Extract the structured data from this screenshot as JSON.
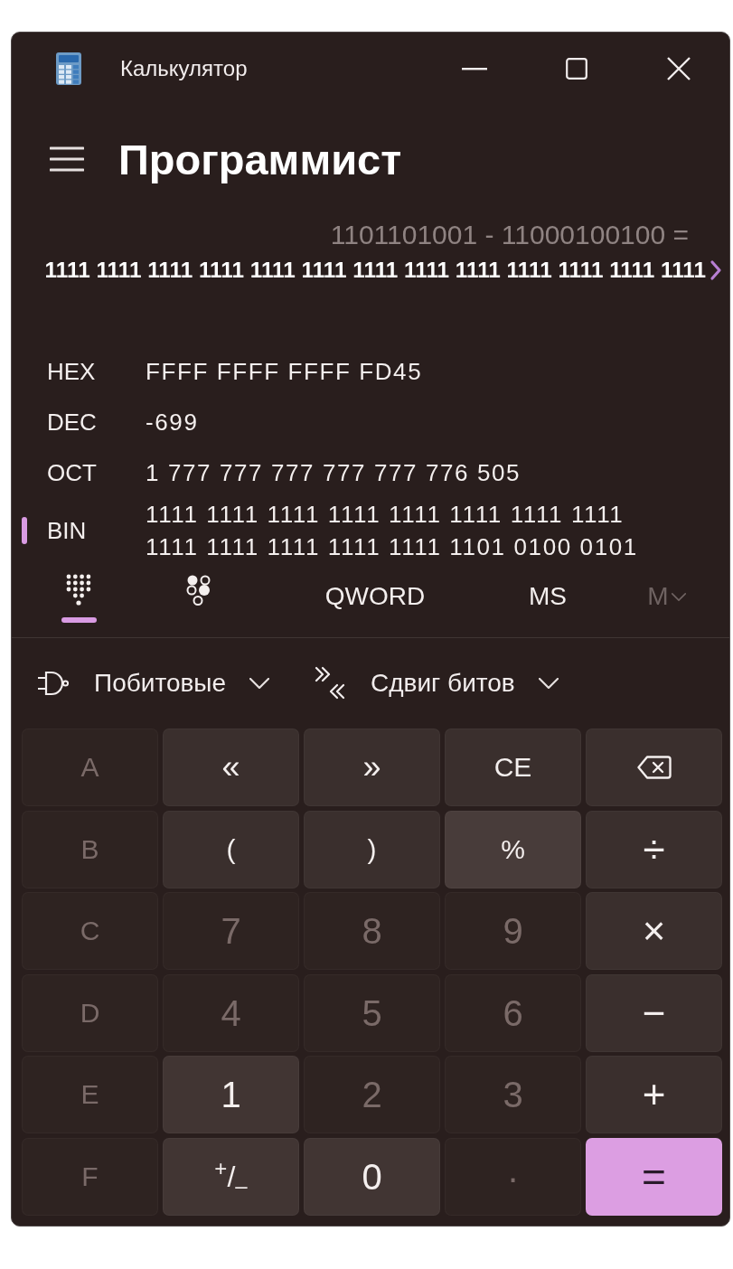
{
  "window": {
    "title": "Калькулятор"
  },
  "header": {
    "title": "Программист"
  },
  "display": {
    "expression": "1101101001 - 11000100100 =",
    "result": "1111 1111 1111 1111 1111 1111 1111 1111 1111 1111 1111 1111 1111"
  },
  "radix": [
    {
      "label": "HEX",
      "value": "FFFF FFFF FFFF FD45",
      "selected": false
    },
    {
      "label": "DEC",
      "value": "-699",
      "selected": false
    },
    {
      "label": "OCT",
      "value": "1 777 777 777 777 777 776 505",
      "selected": false
    },
    {
      "label": "BIN",
      "value": "1111 1111 1111 1111 1111 1111 1111 1111 1111 1111 1111 1111 1111 1101 0100 0101",
      "selected": true
    }
  ],
  "toolbar": {
    "tabs": [
      {
        "kind": "keypad",
        "selected": true
      },
      {
        "kind": "bit_toggle",
        "selected": false
      }
    ],
    "word_size": "QWORD",
    "memory": [
      {
        "kind": "store",
        "label": "MS",
        "disabled": false
      },
      {
        "kind": "list",
        "label": "M",
        "disabled": true
      }
    ]
  },
  "dropdowns": [
    {
      "kind": "bitwise",
      "label": "Побитовые"
    },
    {
      "kind": "shift",
      "label": "Сдвиг битов"
    }
  ],
  "keys": [
    {
      "kind": "hex",
      "label": "A",
      "disabled": true,
      "hovered": false
    },
    {
      "kind": "shift",
      "label": "«",
      "disabled": false,
      "hovered": false
    },
    {
      "kind": "shift",
      "label": "»",
      "disabled": false,
      "hovered": false
    },
    {
      "kind": "function",
      "label": "CE",
      "disabled": false,
      "hovered": false
    },
    {
      "kind": "backspace",
      "disabled": false,
      "hovered": false
    },
    {
      "kind": "hex",
      "label": "B",
      "disabled": true,
      "hovered": false
    },
    {
      "kind": "function",
      "label": "(",
      "disabled": false,
      "hovered": false
    },
    {
      "kind": "function",
      "label": ")",
      "disabled": false,
      "hovered": false
    },
    {
      "kind": "function",
      "label": "%",
      "disabled": false,
      "hovered": true
    },
    {
      "kind": "operator",
      "label": "÷",
      "disabled": false,
      "hovered": false
    },
    {
      "kind": "hex",
      "label": "C",
      "disabled": true,
      "hovered": false
    },
    {
      "kind": "digit",
      "label": "7",
      "disabled": true,
      "hovered": false
    },
    {
      "kind": "digit",
      "label": "8",
      "disabled": true,
      "hovered": false
    },
    {
      "kind": "digit",
      "label": "9",
      "disabled": true,
      "hovered": false
    },
    {
      "kind": "operator",
      "label": "×",
      "disabled": false,
      "hovered": false
    },
    {
      "kind": "hex",
      "label": "D",
      "disabled": true,
      "hovered": false
    },
    {
      "kind": "digit",
      "label": "4",
      "disabled": true,
      "hovered": false
    },
    {
      "kind": "digit",
      "label": "5",
      "disabled": true,
      "hovered": false
    },
    {
      "kind": "digit",
      "label": "6",
      "disabled": true,
      "hovered": false
    },
    {
      "kind": "operator",
      "label": "−",
      "disabled": false,
      "hovered": false
    },
    {
      "kind": "hex",
      "label": "E",
      "disabled": true,
      "hovered": false
    },
    {
      "kind": "digit",
      "label": "1",
      "disabled": false,
      "hovered": false
    },
    {
      "kind": "digit",
      "label": "2",
      "disabled": true,
      "hovered": false
    },
    {
      "kind": "digit",
      "label": "3",
      "disabled": true,
      "hovered": false
    },
    {
      "kind": "operator",
      "label": "+",
      "disabled": false,
      "hovered": false
    },
    {
      "kind": "hex",
      "label": "F",
      "disabled": true,
      "hovered": false
    },
    {
      "kind": "sign",
      "label": "$^{+}$/$_{–}$",
      "disabled": false,
      "hovered": false
    },
    {
      "kind": "digit",
      "label": "0",
      "disabled": false,
      "hovered": false
    },
    {
      "kind": "decimal",
      "label": ".",
      "disabled": true,
      "hovered": false
    },
    {
      "kind": "equals",
      "label": "=",
      "disabled": false,
      "hovered": false
    }
  ]
}
